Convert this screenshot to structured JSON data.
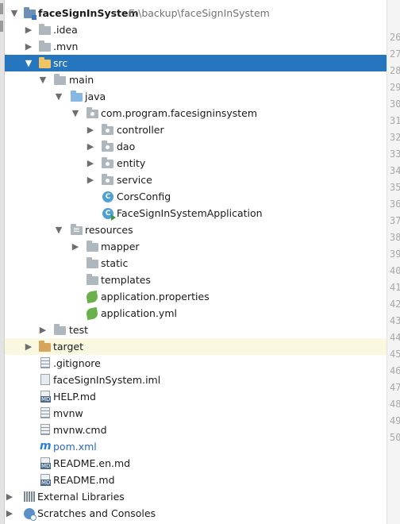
{
  "project": {
    "name": "faceSignInSystem",
    "path": "E:\\backup\\faceSignInSystem"
  },
  "tree": {
    "idea": ".idea",
    "mvn": ".mvn",
    "src": "src",
    "main": "main",
    "java": "java",
    "package": "com.program.facesigninsystem",
    "controller": "controller",
    "dao": "dao",
    "entity": "entity",
    "service": "service",
    "cors_config": "CorsConfig",
    "application_class": "FaceSignInSystemApplication",
    "resources": "resources",
    "mapper": "mapper",
    "static": "static",
    "templates": "templates",
    "application_properties": "application.properties",
    "application_yml": "application.yml",
    "test": "test",
    "target": "target",
    "gitignore": ".gitignore",
    "iml": "faceSignInSystem.iml",
    "help_md": "HELP.md",
    "mvnw": "mvnw",
    "mvnw_cmd": "mvnw.cmd",
    "pom": "pom.xml",
    "readme_en": "README.en.md",
    "readme": "README.md",
    "external_libraries": "External Libraries",
    "scratches": "Scratches and Consoles"
  },
  "gutter_lines": [
    "26",
    "27",
    "28",
    "29",
    "30",
    "31",
    "32",
    "33",
    "34",
    "35",
    "36",
    "37",
    "38",
    "39",
    "40",
    "41",
    "42",
    "43",
    "44",
    "45",
    "46",
    "47",
    "48",
    "49",
    "50"
  ],
  "colors": {
    "selection": "#2675bf",
    "excluded_row": "#fbf8e1",
    "folder": "#aeb6be",
    "source_folder": "#86b8e2",
    "excluded_folder": "#d7a45b"
  }
}
